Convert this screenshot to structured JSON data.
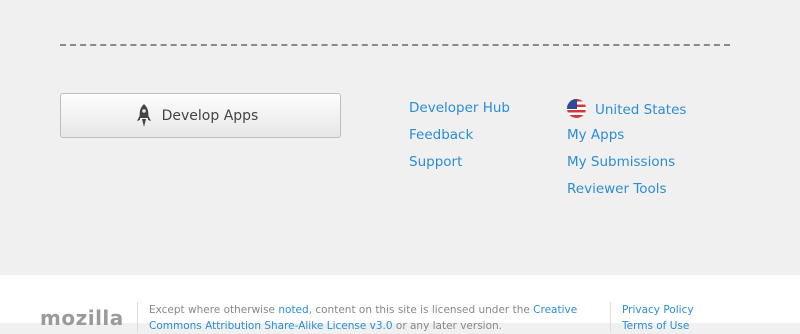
{
  "main": {
    "develop_button_label": "Develop Apps",
    "links_left": [
      "Developer Hub",
      "Feedback",
      "Support"
    ],
    "region_label": "United States",
    "links_right": [
      "My Apps",
      "My Submissions",
      "Reviewer Tools"
    ]
  },
  "footer": {
    "logo_text": "mozilla",
    "legal_prefix": "Except where otherwise ",
    "legal_noted": "noted",
    "legal_mid": ", content on this site is licensed under the ",
    "legal_license": "Creative Commons Attribution Share-Alike License v3.0",
    "legal_suffix": " or any later version.",
    "privacy_label": "Privacy Policy",
    "terms_label": "Terms of Use"
  },
  "colors": {
    "link": "#2b8dd6",
    "upper_background": "#f0f0f0",
    "footer_background": "#ffffff"
  }
}
